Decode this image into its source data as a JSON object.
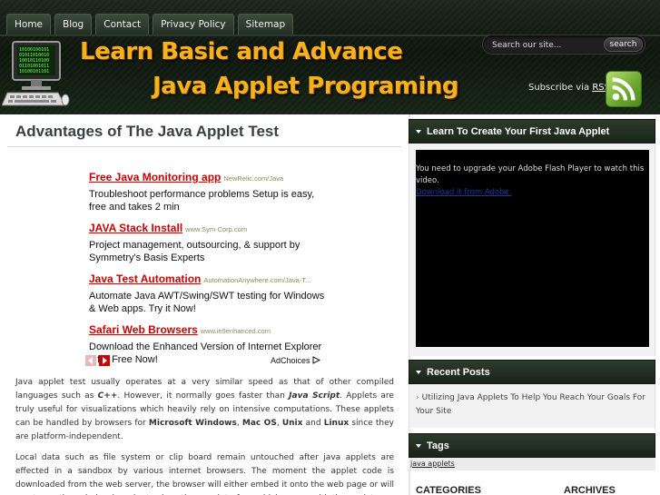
{
  "nav": {
    "items": [
      {
        "label": "Home"
      },
      {
        "label": "Blog"
      },
      {
        "label": "Contact"
      },
      {
        "label": "Privacy Policy"
      },
      {
        "label": "Sitemap"
      }
    ]
  },
  "header": {
    "logo_line1": "Learn Basic and Advance",
    "logo_line2": "Java Applet Programing",
    "search": {
      "placeholder": "Search our site...",
      "button_label": "search"
    },
    "subscribe_prefix": "Subscribe via",
    "subscribe_link": "RSS",
    "rss_icon": "rss-feed-icon",
    "colors": {
      "logo_text": "#f7b11e",
      "header_bg": "#142014"
    }
  },
  "main": {
    "title": "Advantages of The Java Applet Test",
    "ads": [
      {
        "title": "Free Java Monitoring app",
        "url": "NewRelic.com/Java",
        "desc": "Troubleshoot performance problems Setup is easy, free and takes 2 min"
      },
      {
        "title": "JAVA Stack Install",
        "url": "www.Sym-Corp.com",
        "desc": "Project management, outsourcing, & support by Symmetry's Basis Experts"
      },
      {
        "title": "Java Test Automation",
        "url": "AutomationAnywhere.com/Java-T...",
        "desc": "Automate Java AWT/Swing/SWT testing for Windows & Web apps. Try it Now!"
      },
      {
        "title": "Safari Web Browsers",
        "url": "www.ie9enhanced.com",
        "desc": "Download the Enhanced Version of Internet Explorer 9 for Free Now!"
      }
    ],
    "ad_choices": "AdChoices",
    "para1": {
      "t1": "Java applet test usually operates at a very similar speed as that of other compiled languages such as ",
      "b1": "C++",
      "t2": ". However, it normally goes faster than ",
      "b2": "Java Script",
      "t3": ". Applets are truly useful for visualizations which heavily rely on intensive computations. These applets can be handled by browsers for ",
      "b3": "Microsoft Windows",
      "t4": ", ",
      "b4": "Mac OS",
      "t5": ", ",
      "b5": "Unix",
      "t6": " and ",
      "b6": "Linux",
      "t7": " since they are platform-independent."
    },
    "para2": "Local data such as file system or clip board remain untouched after java applets are effected in a sandbox by various internet browsers. The moment the applet code is downloaded from the web server, the browser will either embed it onto the web page or will create another window in order to show the user interface which comes with the applet."
  },
  "sidebar": {
    "video_widget": {
      "title": "Learn To Create Your First Java Applet",
      "message": "You need to upgrade your Adobe Flash Player to watch this video.",
      "link": "Download it from Adobe."
    },
    "recent_posts": {
      "title": "Recent Posts",
      "items": [
        {
          "label": "Utilizing Java Applets To Help You Reach Your Goals For Your Site"
        }
      ]
    },
    "tags": {
      "title": "Tags",
      "items": [
        {
          "label": "java applets"
        }
      ]
    },
    "categories_title": "CATEGORIES",
    "archives_title": "ARCHIVES"
  }
}
